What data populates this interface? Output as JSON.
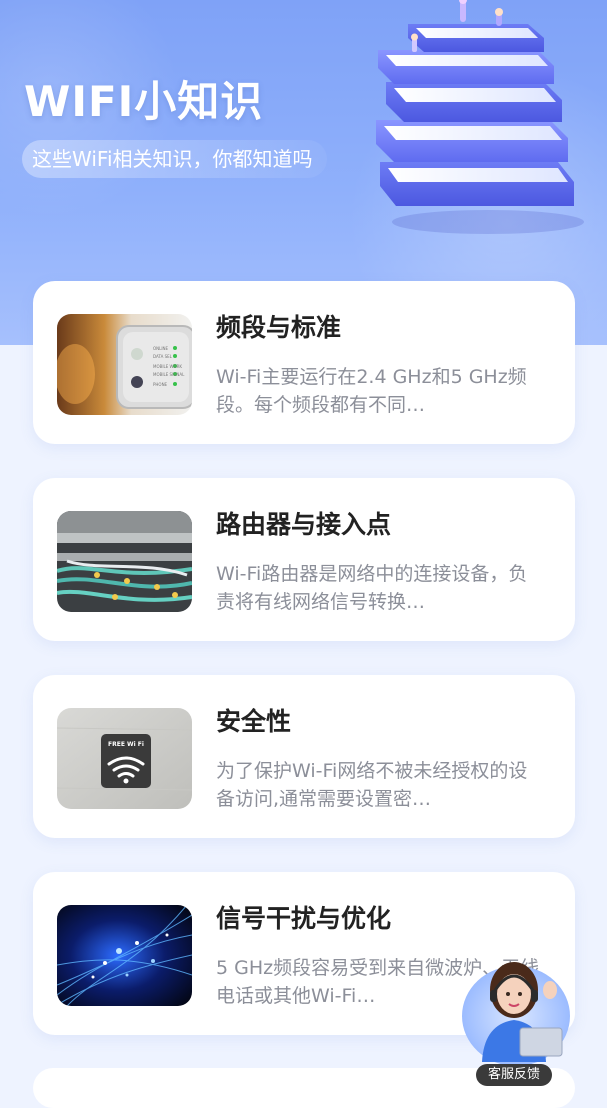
{
  "header": {
    "title": "WIFI小知识",
    "subtitle": "这些WiFi相关知识，你都知道吗"
  },
  "articles": [
    {
      "title": "频段与标准",
      "desc": "Wi-Fi主要运行在2.4 GHz和5 GHz频段。每个频段都有不同…",
      "thumb_icon": "router-panel-image",
      "thumb_labels": [
        "ONLINE",
        "DATA SEL",
        "MOBILE WORK",
        "MOBILE SIGNAL",
        "PHONE"
      ]
    },
    {
      "title": "路由器与接入点",
      "desc": "Wi-Fi路由器是网络中的连接设备，负责将有线网络信号转换…",
      "thumb_icon": "network-cables-image"
    },
    {
      "title": "安全性",
      "desc": "为了保护Wi-Fi网络不被未经授权的设备访问,通常需要设置密…",
      "thumb_icon": "free-wifi-sign-image",
      "thumb_sign": "FREE Wi Fi"
    },
    {
      "title": "信号干扰与优化",
      "desc": "5 GHz频段容易受到来自微波炉、无线电话或其他Wi-Fi…",
      "thumb_icon": "fiber-optics-image"
    }
  ],
  "service": {
    "label": "客服反馈",
    "icon": "customer-service-avatar"
  },
  "colors": {
    "hero": "#8fb0fb",
    "background": "#eef3ff",
    "title": "#222222",
    "desc": "#8c8f99"
  }
}
